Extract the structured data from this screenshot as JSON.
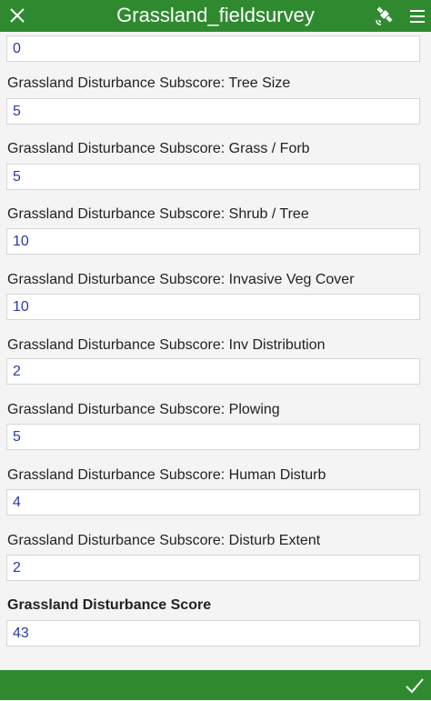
{
  "header": {
    "title": "Grassland_fieldsurvey",
    "close_icon": "close-icon",
    "gps_icon": "satellite-icon",
    "menu_icon": "hamburger-menu-icon"
  },
  "fields": [
    {
      "label": "",
      "value": "0"
    },
    {
      "label": "Grassland Disturbance Subscore: Tree Size",
      "value": "5"
    },
    {
      "label": "Grassland Disturbance Subscore: Grass / Forb",
      "value": "5"
    },
    {
      "label": "Grassland Disturbance Subscore: Shrub / Tree",
      "value": "10"
    },
    {
      "label": "Grassland Disturbance Subscore: Invasive Veg Cover",
      "value": "10"
    },
    {
      "label": "Grassland Disturbance Subscore: Inv Distribution",
      "value": "2"
    },
    {
      "label": "Grassland Disturbance Subscore: Plowing",
      "value": "5"
    },
    {
      "label": "Grassland Disturbance Subscore: Human Disturb",
      "value": "4"
    },
    {
      "label": "Grassland Disturbance Subscore: Disturb Extent",
      "value": "2"
    },
    {
      "label": "Grassland Disturbance Score",
      "value": "43"
    }
  ],
  "footer": {
    "submit_icon": "checkmark-icon"
  },
  "colors": {
    "header_bg": "#2f8a2f",
    "value_text": "#2a3ba8"
  }
}
